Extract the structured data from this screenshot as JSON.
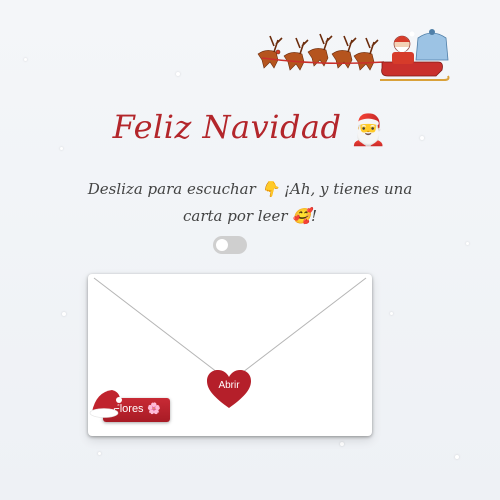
{
  "header": {
    "title": "Feliz Navidad",
    "title_emoji": "🎅",
    "subtitle": "Desliza para escuchar 👇 ¡Ah, y tienes una carta por leer 🥰!"
  },
  "music_toggle": {
    "state": "off"
  },
  "letter": {
    "open_label": "Abrir",
    "flowers_label": "Flores",
    "flowers_emoji": "🌸"
  },
  "decor": {
    "sleigh_icon": "santa-sleigh-reindeer-icon",
    "hat_icon": "santa-hat-icon"
  },
  "colors": {
    "accent_red": "#b3262b",
    "button_red": "#c82a35",
    "toggle_off": "#cfcfcf"
  }
}
